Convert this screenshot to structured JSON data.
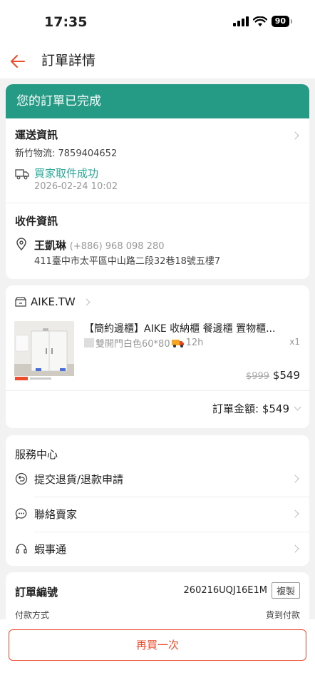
{
  "status_bar": {
    "time": "17:35",
    "battery": "90"
  },
  "nav": {
    "title": "訂單詳情"
  },
  "order_status": {
    "banner": "您的訂單已完成"
  },
  "shipping": {
    "title": "運送資訊",
    "carrier_tracking": "新竹物流: 7859404652",
    "event": "買家取件成功",
    "event_time": "2026-02-24 10:02"
  },
  "recipient": {
    "title": "收件資訊",
    "name": "王凱琳",
    "phone": "(+886) 968 098 280",
    "address": "411臺中市太平區中山路二段32巷18號五樓7"
  },
  "shop": {
    "name": "AIKE.TW",
    "product": {
      "title": "【簡約邊櫃】AIKE 收納櫃 餐邊櫃 置物櫃...",
      "variant": "雙開門白色60*80",
      "shipping_badge": "12h",
      "qty": "x1",
      "original_price": "$999",
      "price": "$549"
    },
    "order_total": "訂單金額: $549"
  },
  "service_center": {
    "title": "服務中心",
    "items": [
      {
        "label": "提交退貨/退款申請",
        "icon": "return-icon"
      },
      {
        "label": "聯絡賣家",
        "icon": "chat-icon"
      },
      {
        "label": "蝦事通",
        "icon": "headset-icon"
      }
    ]
  },
  "order_info": {
    "order_no_label": "訂單編號",
    "order_no": "260216UQJ16E1M",
    "copy_label": "複製",
    "payment_label": "付款方式",
    "payment_value": "貨到付款"
  },
  "footer": {
    "buy_again": "再買一次"
  },
  "colors": {
    "accent": "#ee4d2d",
    "banner": "#259b85",
    "link_green": "#26aa99"
  }
}
